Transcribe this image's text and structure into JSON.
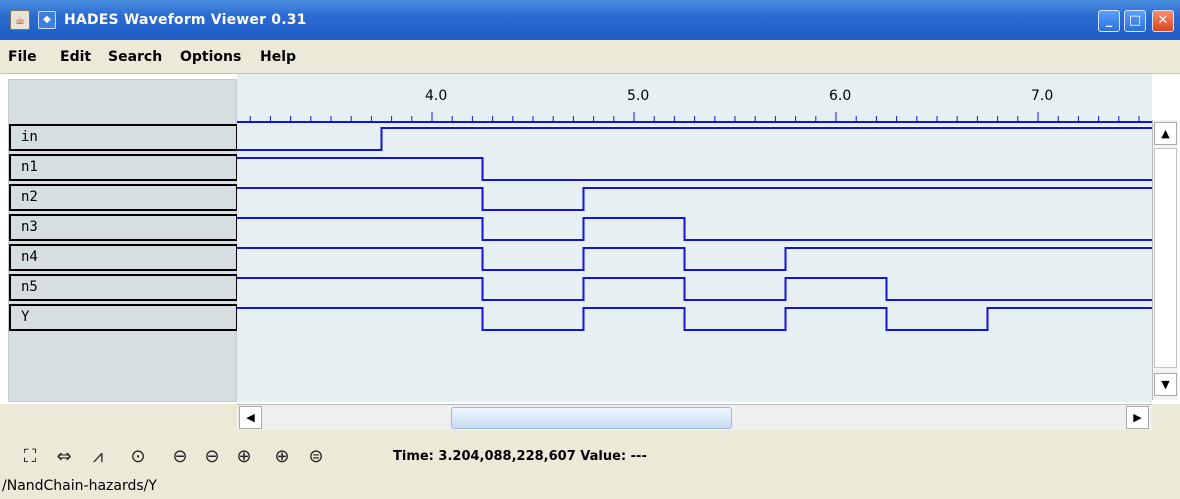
{
  "window": {
    "title": "HADES Waveform Viewer 0.31"
  },
  "menubar": {
    "file": "File",
    "edit": "Edit",
    "search": "Search",
    "options": "Options",
    "help": "Help"
  },
  "signals": [
    {
      "name": "in",
      "transitions": [
        3.75
      ],
      "initial": 0
    },
    {
      "name": "n1",
      "transitions": [
        4.25
      ],
      "initial": 1
    },
    {
      "name": "n2",
      "transitions": [
        4.25,
        4.75
      ],
      "initial": 1
    },
    {
      "name": "n3",
      "transitions": [
        4.25,
        4.75,
        5.25
      ],
      "initial": 1
    },
    {
      "name": "n4",
      "transitions": [
        4.25,
        4.75,
        5.25,
        5.75
      ],
      "initial": 1
    },
    {
      "name": "n5",
      "transitions": [
        4.25,
        4.75,
        5.25,
        5.75,
        6.25
      ],
      "initial": 1
    },
    {
      "name": "Y",
      "transitions": [
        4.25,
        4.75,
        5.25,
        5.75,
        6.25,
        6.75
      ],
      "initial": 1
    }
  ],
  "timeline": {
    "labels": [
      "4.0",
      "5.0",
      "6.0",
      "7.0"
    ],
    "start": 3.0,
    "end": 7.5
  },
  "toolbar": {
    "time_label": "Time: 3.204,088,228,607  Value: ---"
  },
  "status": {
    "path": "/NandChain-hazards/Y"
  },
  "colors": {
    "wave": "#1414d8",
    "plot_bg": "#e6f0f2",
    "names_bg": "#d6dee2"
  }
}
